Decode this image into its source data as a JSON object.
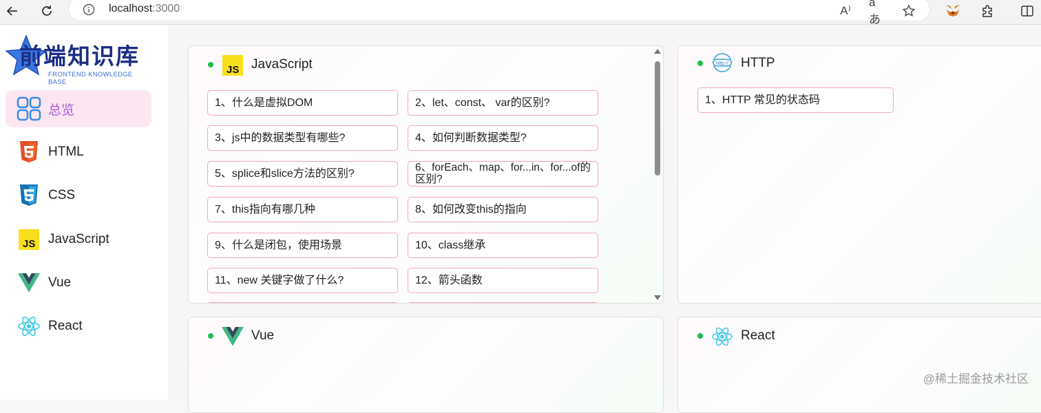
{
  "browser": {
    "url_host": "localhost",
    "url_port": ":3000",
    "icons": [
      "back-icon",
      "refresh-icon",
      "info-icon",
      "read-aloud-icon",
      "translate-icon",
      "favorite-star-icon",
      "metamask-fox-icon",
      "extensions-icon",
      "split-view-icon"
    ],
    "read_aloud_label": "A⁾",
    "translate_label": "aあ"
  },
  "logo": {
    "title": "前端知识库",
    "subtitle": "FRONTEND KNOWLEDGE BASE"
  },
  "sidebar": {
    "items": [
      {
        "label": "总览",
        "icon": "grid-icon",
        "active": true
      },
      {
        "label": "HTML",
        "icon": "html5-icon",
        "active": false
      },
      {
        "label": "CSS",
        "icon": "css3-icon",
        "active": false
      },
      {
        "label": "JavaScript",
        "icon": "javascript-icon",
        "active": false
      },
      {
        "label": "Vue",
        "icon": "vue-icon",
        "active": false
      },
      {
        "label": "React",
        "icon": "react-icon",
        "active": false
      }
    ]
  },
  "cards": {
    "javascript": {
      "title": "JavaScript",
      "icon": "javascript-icon",
      "questions": [
        "1、什么是虚拟DOM",
        "2、let、const、 var的区别?",
        "3、js中的数据类型有哪些?",
        "4、如何判断数据类型?",
        "5、splice和slice方法的区别?",
        "6、forEach、map、for...in、for...of的区别?",
        "7、this指向有哪几种",
        "8、如何改变this的指向",
        "9、什么是闭包，使用场景",
        "10、class继承",
        "11、new 关键字做了什么?",
        "12、箭头函数"
      ]
    },
    "http": {
      "title": "HTTP",
      "icon": "http-icon",
      "questions": [
        "1、HTTP 常见的状态码"
      ]
    },
    "vue": {
      "title": "Vue",
      "icon": "vue-icon",
      "questions": []
    },
    "react": {
      "title": "React",
      "icon": "react-icon",
      "questions": []
    }
  },
  "colors": {
    "status_dot": "#1dbe52",
    "question_border": "#f2a5c9",
    "active_menu_bg": "#fbe6f1",
    "active_menu_text": "#a55bd8",
    "logo_blue": "#1d2f85"
  },
  "watermark": "@稀土掘金技术社区"
}
